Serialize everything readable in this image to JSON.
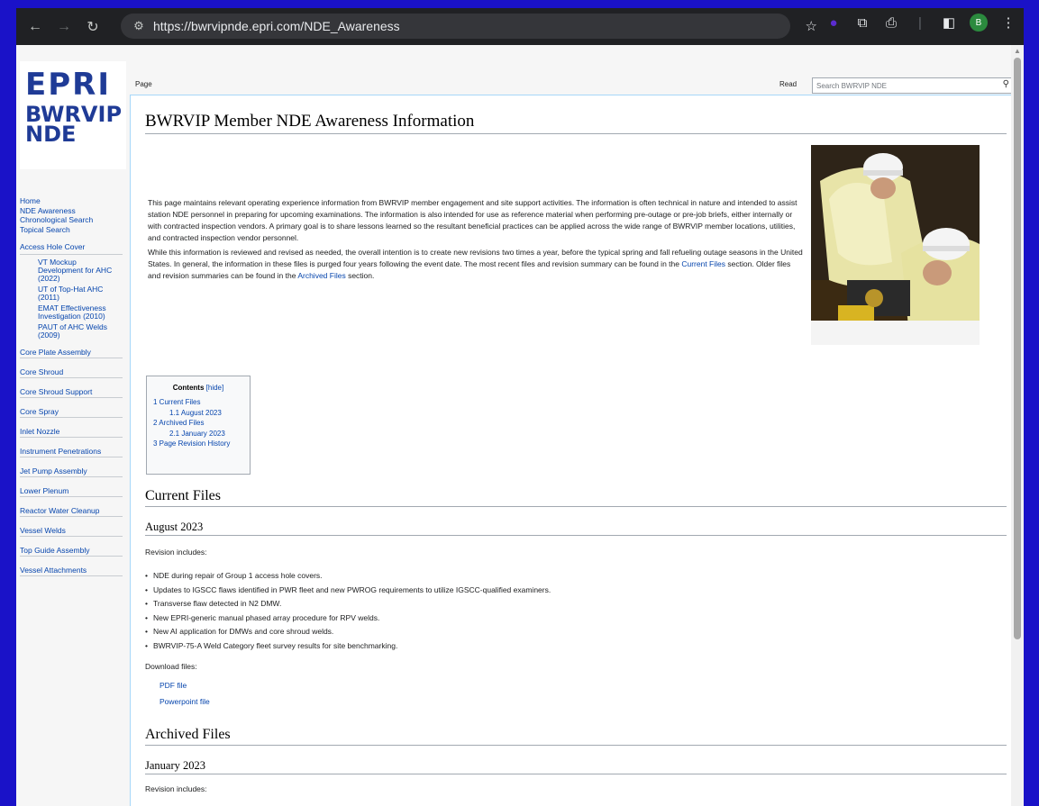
{
  "browser": {
    "url": "https://bwrvipnde.epri.com/NDE_Awareness",
    "profile_initial": "B"
  },
  "logo": {
    "line1": "EPRI",
    "line2": "BWRVIP",
    "line3": "NDE"
  },
  "sidebar": {
    "top_links": [
      "Home",
      "NDE Awareness",
      "Chronological Search",
      "Topical Search"
    ],
    "group_heading": "Access Hole Cover",
    "group_items": [
      [
        "VT Mockup",
        "Development for AHC",
        "(2022)"
      ],
      [
        "UT of Top-Hat AHC",
        "(2011)"
      ],
      [
        "EMAT Effectiveness",
        "Investigation (2010)"
      ],
      [
        "PAUT of AHC Welds",
        "(2009)"
      ]
    ],
    "sections": [
      "Core Plate Assembly",
      "Core Shroud",
      "Core Shroud Support",
      "Core Spray",
      "Inlet Nozzle",
      "Instrument Penetrations",
      "Jet Pump Assembly",
      "Lower Plenum",
      "Reactor Water Cleanup",
      "Vessel Welds",
      "Top Guide Assembly",
      "Vessel Attachments"
    ]
  },
  "tabs": {
    "page": "Page",
    "read": "Read"
  },
  "search": {
    "placeholder": "Search BWRVIP NDE"
  },
  "page": {
    "title": "BWRVIP Member NDE Awareness Information",
    "intro_p1": "This page maintains relevant operating experience information from BWRVIP member engagement and site support activities. The information is often technical in nature and intended to assist station NDE personnel in preparing for upcoming examinations. The information is also intended for use as reference material when performing pre-outage or pre-job briefs, either internally or with contracted inspection vendors. A primary goal is to share lessons learned so the resultant beneficial practices can be applied across the wide range of BWRVIP member locations, utilities, and contracted inspection vendor personnel.",
    "intro_p2a": "While this information is reviewed and revised as needed, the overall intention is to create new revisions two times a year, before the typical spring and fall refueling outage seasons in the United States. In general, the information in these files is purged four years following the event date. The most recent files and revision summary can be found in the ",
    "intro_link1": "Current Files",
    "intro_p2b": " section. Older files and revision summaries can be found in the ",
    "intro_link2": "Archived Files",
    "intro_p2c": " section."
  },
  "toc": {
    "title": "Contents",
    "hide": "[hide]",
    "items": [
      "1 Current Files",
      "1.1 August 2023",
      "2 Archived Files",
      "2.1 January 2023",
      "3 Page Revision History"
    ]
  },
  "current": {
    "heading": "Current Files",
    "sub": "August 2023",
    "rev_label": "Revision includes:",
    "bullets": [
      "NDE during repair of Group 1 access hole covers.",
      "Updates to IGSCC flaws identified in PWR fleet and new PWROG requirements to utilize IGSCC-qualified examiners.",
      "Transverse flaw detected in N2 DMW.",
      "New EPRI-generic manual phased array procedure for RPV welds.",
      "New AI application for DMWs and core shroud welds.",
      "BWRVIP-75-A Weld Category fleet survey results for site benchmarking."
    ],
    "download_label": "Download files:",
    "pdf": "PDF file",
    "ppt": "Powerpoint file"
  },
  "archived": {
    "heading": "Archived Files",
    "sub": "January 2023",
    "rev_label": "Revision includes:"
  }
}
